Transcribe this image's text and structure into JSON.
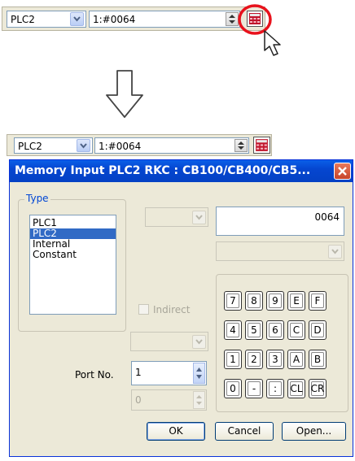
{
  "top_toolbar": {
    "plc_select": "PLC2",
    "address_value": "1:#0064"
  },
  "bottom_toolbar": {
    "plc_select": "PLC2",
    "address_value": "1:#0064"
  },
  "dialog": {
    "title": "Memory Input  PLC2 RKC : CB100/CB400/CB5...",
    "type_group": {
      "legend": "Type",
      "items": [
        "PLC1",
        "PLC2",
        "Internal",
        "Constant"
      ],
      "selected_index": 1
    },
    "value_field": "0064",
    "indirect_label": "Indirect",
    "port_label": "Port No.",
    "port_value": "1",
    "indirect_port_value": "0",
    "keypad": [
      [
        "7",
        "8",
        "9",
        "E",
        "F"
      ],
      [
        "4",
        "5",
        "6",
        "C",
        "D"
      ],
      [
        "1",
        "2",
        "3",
        "A",
        "B"
      ],
      [
        "0",
        "-",
        ":",
        "CL",
        "CR"
      ]
    ],
    "buttons": {
      "ok": "OK",
      "cancel": "Cancel",
      "open": "Open..."
    }
  },
  "colors": {
    "highlight_circle": "#e8121c",
    "title_bar": "#0a54e0",
    "selection": "#316ac5"
  },
  "icons": [
    "chevron-down-icon",
    "spin-arrows-icon",
    "calculator-icon",
    "mouse-cursor-icon",
    "down-arrow-icon",
    "close-icon"
  ]
}
